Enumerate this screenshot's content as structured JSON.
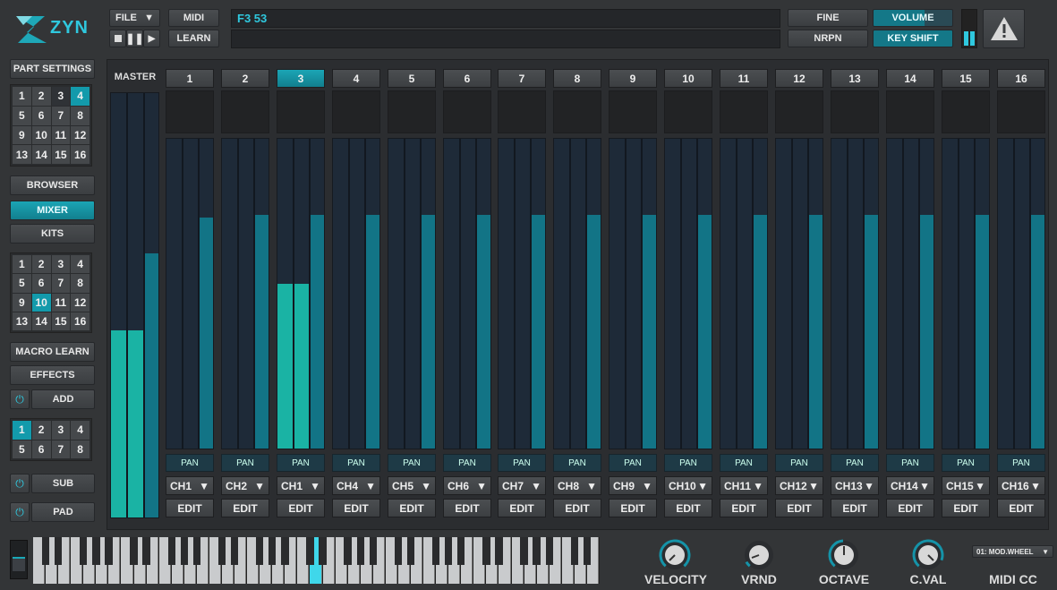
{
  "header": {
    "logo": "ZYN",
    "file_label": "FILE",
    "midi_label": "MIDI",
    "learn_label": "LEARN",
    "display_line1": "F3 53",
    "display_line2": "",
    "fine_label": "FINE",
    "nrpn_label": "NRPN",
    "volume_label": "VOLUME",
    "keyshift_label": "KEY SHIFT"
  },
  "sidebar": {
    "part_settings": "PART SETTINGS",
    "part_grid": [
      "1",
      "2",
      "3",
      "4",
      "5",
      "6",
      "7",
      "8",
      "9",
      "10",
      "11",
      "12",
      "13",
      "14",
      "15",
      "16"
    ],
    "part_grid_active": 4,
    "browser": "BROWSER",
    "mixer": "MIXER",
    "kits": "KITS",
    "kit_grid": [
      "1",
      "2",
      "3",
      "4",
      "5",
      "6",
      "7",
      "8",
      "9",
      "10",
      "11",
      "12",
      "13",
      "14",
      "15",
      "16"
    ],
    "kit_grid_active": 10,
    "macro_learn": "MACRO LEARN",
    "effects": "EFFECTS",
    "add": "ADD",
    "fx_grid": [
      "1",
      "2",
      "3",
      "4",
      "5",
      "6",
      "7",
      "8"
    ],
    "fx_grid_active": 1,
    "sub": "SUB",
    "pad": "PAD"
  },
  "mixer": {
    "master_label": "MASTER",
    "master_level": 0.44,
    "master_volume": 0.62,
    "active_strip": 3,
    "pan_label": "PAN",
    "edit_label": "EDIT",
    "strips": [
      {
        "num": "1",
        "ch": "CH1",
        "volume": 0.74,
        "meter": 0
      },
      {
        "num": "2",
        "ch": "CH2",
        "volume": 0.75,
        "meter": 0
      },
      {
        "num": "3",
        "ch": "CH1",
        "volume": 0.75,
        "meter": 0.53
      },
      {
        "num": "4",
        "ch": "CH4",
        "volume": 0.75,
        "meter": 0
      },
      {
        "num": "5",
        "ch": "CH5",
        "volume": 0.75,
        "meter": 0
      },
      {
        "num": "6",
        "ch": "CH6",
        "volume": 0.75,
        "meter": 0
      },
      {
        "num": "7",
        "ch": "CH7",
        "volume": 0.75,
        "meter": 0
      },
      {
        "num": "8",
        "ch": "CH8",
        "volume": 0.75,
        "meter": 0
      },
      {
        "num": "9",
        "ch": "CH9",
        "volume": 0.75,
        "meter": 0
      },
      {
        "num": "10",
        "ch": "CH10",
        "volume": 0.75,
        "meter": 0
      },
      {
        "num": "11",
        "ch": "CH11",
        "volume": 0.75,
        "meter": 0
      },
      {
        "num": "12",
        "ch": "CH12",
        "volume": 0.75,
        "meter": 0
      },
      {
        "num": "13",
        "ch": "CH13",
        "volume": 0.75,
        "meter": 0
      },
      {
        "num": "14",
        "ch": "CH14",
        "volume": 0.75,
        "meter": 0
      },
      {
        "num": "15",
        "ch": "CH15",
        "volume": 0.75,
        "meter": 0
      },
      {
        "num": "16",
        "ch": "CH16",
        "volume": 0.75,
        "meter": 0
      }
    ]
  },
  "bottom": {
    "velocity": "VELOCITY",
    "vrnd": "VRND",
    "octave": "OCTAVE",
    "cval": "C.VAL",
    "midicc": "MIDI CC",
    "midicc_select": "01: MOD.WHEEL"
  },
  "colors": {
    "accent": "#139aab",
    "meter": "#1ab3a4",
    "fader": "#127486"
  }
}
